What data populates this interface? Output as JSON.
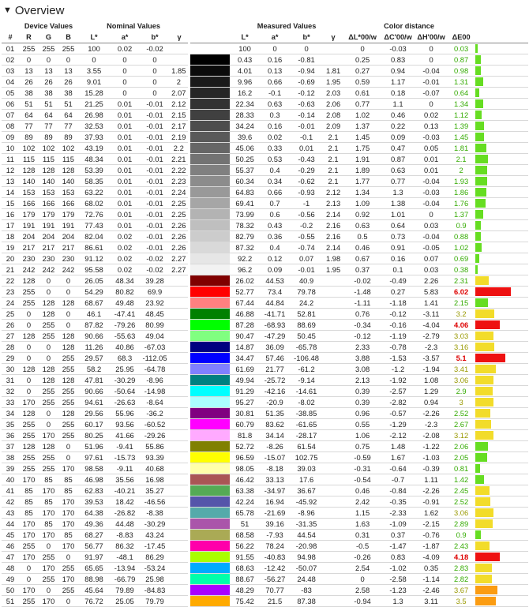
{
  "section": {
    "toggle_icon": "triangle-down-icon",
    "title": "Overview"
  },
  "groups": {
    "device": "Device Values",
    "nominal": "Nominal Values",
    "measured": "Measured Values",
    "distance": "Color distance"
  },
  "columns": [
    "#",
    "R",
    "G",
    "B",
    "L*",
    "a*",
    "b*",
    "γ",
    "",
    "L*",
    "a*",
    "b*",
    "γ",
    "ΔL*00/w",
    "ΔC'00/w",
    "ΔH'00/w",
    "ΔE00",
    ""
  ],
  "colors": {
    "good": "#66dd22",
    "ok": "#f2dc2a",
    "warn": "#fb9c12",
    "bad": "#ee1111",
    "bad_text": "#dd0000",
    "good_text": "#33aa00",
    "ok_text": "#999900"
  },
  "rows": [
    [
      "01",
      "255",
      "255",
      "255",
      "100",
      "0.02",
      "-0.02",
      "",
      "#ffffff",
      "100",
      "0",
      "0",
      "",
      "0",
      "-0.03",
      "0",
      "0.03"
    ],
    [
      "02",
      "0",
      "0",
      "0",
      "0",
      "0",
      "0",
      "",
      "#000000",
      "0.43",
      "0.16",
      "-0.81",
      "",
      "0.25",
      "0.83",
      "0",
      "0.87"
    ],
    [
      "03",
      "13",
      "13",
      "13",
      "3.55",
      "0",
      "0",
      "1.85",
      "#0b0b0b",
      "4.01",
      "0.13",
      "-0.94",
      "1.81",
      "0.27",
      "0.94",
      "-0.04",
      "0.98"
    ],
    [
      "04",
      "26",
      "26",
      "26",
      "9.01",
      "0",
      "0",
      "2",
      "#1a1a1a",
      "9.96",
      "0.66",
      "-0.69",
      "1.95",
      "0.59",
      "1.17",
      "-0.01",
      "1.31"
    ],
    [
      "05",
      "38",
      "38",
      "38",
      "15.28",
      "0",
      "0",
      "2.07",
      "#262626",
      "16.2",
      "-0.1",
      "-0.12",
      "2.03",
      "0.61",
      "0.18",
      "-0.07",
      "0.64"
    ],
    [
      "06",
      "51",
      "51",
      "51",
      "21.25",
      "0.01",
      "-0.01",
      "2.12",
      "#333333",
      "22.34",
      "0.63",
      "-0.63",
      "2.06",
      "0.77",
      "1.1",
      "0",
      "1.34"
    ],
    [
      "07",
      "64",
      "64",
      "64",
      "26.98",
      "0.01",
      "-0.01",
      "2.15",
      "#404040",
      "28.33",
      "0.3",
      "-0.14",
      "2.08",
      "1.02",
      "0.46",
      "0.02",
      "1.12"
    ],
    [
      "08",
      "77",
      "77",
      "77",
      "32.53",
      "0.01",
      "-0.01",
      "2.17",
      "#4d4d4d",
      "34.24",
      "0.16",
      "-0.01",
      "2.09",
      "1.37",
      "0.22",
      "0.13",
      "1.39"
    ],
    [
      "09",
      "89",
      "89",
      "89",
      "37.93",
      "0.01",
      "-0.01",
      "2.19",
      "#595959",
      "39.6",
      "0.02",
      "-0.1",
      "2.1",
      "1.45",
      "0.09",
      "-0.03",
      "1.45"
    ],
    [
      "10",
      "102",
      "102",
      "102",
      "43.19",
      "0.01",
      "-0.01",
      "2.2",
      "#666666",
      "45.06",
      "0.33",
      "0.01",
      "2.1",
      "1.75",
      "0.47",
      "0.05",
      "1.81"
    ],
    [
      "11",
      "115",
      "115",
      "115",
      "48.34",
      "0.01",
      "-0.01",
      "2.21",
      "#737373",
      "50.25",
      "0.53",
      "-0.43",
      "2.1",
      "1.91",
      "0.87",
      "0.01",
      "2.1"
    ],
    [
      "12",
      "128",
      "128",
      "128",
      "53.39",
      "0.01",
      "-0.01",
      "2.22",
      "#808080",
      "55.37",
      "0.4",
      "-0.29",
      "2.1",
      "1.89",
      "0.63",
      "0.01",
      "2"
    ],
    [
      "13",
      "140",
      "140",
      "140",
      "58.35",
      "0.01",
      "-0.01",
      "2.23",
      "#8c8c8c",
      "60.34",
      "0.34",
      "-0.62",
      "2.1",
      "1.77",
      "0.77",
      "-0.04",
      "1.93"
    ],
    [
      "14",
      "153",
      "153",
      "153",
      "63.22",
      "0.01",
      "-0.01",
      "2.24",
      "#999999",
      "64.83",
      "0.66",
      "-0.93",
      "2.12",
      "1.34",
      "1.3",
      "-0.03",
      "1.86"
    ],
    [
      "15",
      "166",
      "166",
      "166",
      "68.02",
      "0.01",
      "-0.01",
      "2.25",
      "#a6a6a6",
      "69.41",
      "0.7",
      "-1",
      "2.13",
      "1.09",
      "1.38",
      "-0.04",
      "1.76"
    ],
    [
      "16",
      "179",
      "179",
      "179",
      "72.76",
      "0.01",
      "-0.01",
      "2.25",
      "#b3b3b3",
      "73.99",
      "0.6",
      "-0.56",
      "2.14",
      "0.92",
      "1.01",
      "0",
      "1.37"
    ],
    [
      "17",
      "191",
      "191",
      "191",
      "77.43",
      "0.01",
      "-0.01",
      "2.26",
      "#bfbfbf",
      "78.32",
      "0.43",
      "-0.2",
      "2.16",
      "0.63",
      "0.64",
      "0.03",
      "0.9"
    ],
    [
      "18",
      "204",
      "204",
      "204",
      "82.04",
      "0.02",
      "-0.01",
      "2.26",
      "#cccccc",
      "82.79",
      "0.36",
      "-0.55",
      "2.16",
      "0.5",
      "0.73",
      "-0.04",
      "0.88"
    ],
    [
      "19",
      "217",
      "217",
      "217",
      "86.61",
      "0.02",
      "-0.01",
      "2.26",
      "#d9d9d9",
      "87.32",
      "0.4",
      "-0.74",
      "2.14",
      "0.46",
      "0.91",
      "-0.05",
      "1.02"
    ],
    [
      "20",
      "230",
      "230",
      "230",
      "91.12",
      "0.02",
      "-0.02",
      "2.27",
      "#e6e6e6",
      "92.2",
      "0.12",
      "0.07",
      "1.98",
      "0.67",
      "0.16",
      "0.07",
      "0.69"
    ],
    [
      "21",
      "242",
      "242",
      "242",
      "95.58",
      "0.02",
      "-0.02",
      "2.27",
      "#f2f2f2",
      "96.2",
      "0.09",
      "-0.01",
      "1.95",
      "0.37",
      "0.1",
      "0.03",
      "0.38"
    ],
    [
      "22",
      "128",
      "0",
      "0",
      "26.05",
      "48.34",
      "39.28",
      "",
      "#800000",
      "26.02",
      "44.53",
      "40.9",
      "",
      "-0.02",
      "-0.49",
      "2.26",
      "2.31"
    ],
    [
      "23",
      "255",
      "0",
      "0",
      "54.29",
      "80.82",
      "69.9",
      "",
      "#ff0000",
      "52.77",
      "73.4",
      "79.78",
      "",
      "-1.48",
      "0.27",
      "5.83",
      "6.02"
    ],
    [
      "24",
      "255",
      "128",
      "128",
      "68.67",
      "49.48",
      "23.92",
      "",
      "#ff8080",
      "67.44",
      "44.84",
      "24.2",
      "",
      "-1.11",
      "-1.18",
      "1.41",
      "2.15"
    ],
    [
      "25",
      "0",
      "128",
      "0",
      "46.1",
      "-47.41",
      "48.45",
      "",
      "#008000",
      "46.88",
      "-41.71",
      "52.81",
      "",
      "0.76",
      "-0.12",
      "-3.11",
      "3.2"
    ],
    [
      "26",
      "0",
      "255",
      "0",
      "87.82",
      "-79.26",
      "80.99",
      "",
      "#00ff00",
      "87.28",
      "-68.93",
      "88.69",
      "",
      "-0.34",
      "-0.16",
      "-4.04",
      "4.06"
    ],
    [
      "27",
      "128",
      "255",
      "128",
      "90.66",
      "-55.63",
      "49.04",
      "",
      "#80ff80",
      "90.47",
      "-47.29",
      "50.45",
      "",
      "-0.12",
      "-1.19",
      "-2.79",
      "3.03"
    ],
    [
      "28",
      "0",
      "0",
      "128",
      "11.26",
      "40.86",
      "-67.03",
      "",
      "#000080",
      "14.87",
      "36.09",
      "-65.78",
      "",
      "2.33",
      "-0.78",
      "-2.3",
      "3.16"
    ],
    [
      "29",
      "0",
      "0",
      "255",
      "29.57",
      "68.3",
      "-112.05",
      "",
      "#0000ff",
      "34.47",
      "57.46",
      "-106.48",
      "",
      "3.88",
      "-1.53",
      "-3.57",
      "5.1"
    ],
    [
      "30",
      "128",
      "128",
      "255",
      "58.2",
      "25.95",
      "-64.78",
      "",
      "#8080ff",
      "61.69",
      "21.77",
      "-61.2",
      "",
      "3.08",
      "-1.2",
      "-1.94",
      "3.41"
    ],
    [
      "31",
      "0",
      "128",
      "128",
      "47.81",
      "-30.29",
      "-8.96",
      "",
      "#008080",
      "49.94",
      "-25.72",
      "-9.14",
      "",
      "2.13",
      "-1.92",
      "1.08",
      "3.06"
    ],
    [
      "32",
      "0",
      "255",
      "255",
      "90.66",
      "-50.64",
      "-14.98",
      "",
      "#00ffff",
      "91.29",
      "-42.16",
      "-14.61",
      "",
      "0.39",
      "-2.57",
      "1.29",
      "2.9"
    ],
    [
      "33",
      "170",
      "255",
      "255",
      "94.61",
      "-26.63",
      "-8.64",
      "",
      "#aaffff",
      "95.27",
      "-20.9",
      "-8.02",
      "",
      "0.39",
      "-2.82",
      "0.94",
      "3"
    ],
    [
      "34",
      "128",
      "0",
      "128",
      "29.56",
      "55.96",
      "-36.2",
      "",
      "#800080",
      "30.81",
      "51.35",
      "-38.85",
      "",
      "0.96",
      "-0.57",
      "-2.26",
      "2.52"
    ],
    [
      "35",
      "255",
      "0",
      "255",
      "60.17",
      "93.56",
      "-60.52",
      "",
      "#ff00ff",
      "60.79",
      "83.62",
      "-61.65",
      "",
      "0.55",
      "-1.29",
      "-2.3",
      "2.67"
    ],
    [
      "36",
      "255",
      "170",
      "255",
      "80.25",
      "41.66",
      "-29.26",
      "",
      "#ffaaff",
      "81.8",
      "34.14",
      "-28.17",
      "",
      "1.06",
      "-2.12",
      "-2.08",
      "3.12"
    ],
    [
      "37",
      "128",
      "128",
      "0",
      "51.96",
      "-9.41",
      "55.86",
      "",
      "#808000",
      "52.72",
      "-8.26",
      "61.54",
      "",
      "0.75",
      "1.48",
      "-1.22",
      "2.06"
    ],
    [
      "38",
      "255",
      "255",
      "0",
      "97.61",
      "-15.73",
      "93.39",
      "",
      "#ffff00",
      "96.59",
      "-15.07",
      "102.75",
      "",
      "-0.59",
      "1.67",
      "-1.03",
      "2.05"
    ],
    [
      "39",
      "255",
      "255",
      "170",
      "98.58",
      "-9.11",
      "40.68",
      "",
      "#ffffaa",
      "98.05",
      "-8.18",
      "39.03",
      "",
      "-0.31",
      "-0.64",
      "-0.39",
      "0.81"
    ],
    [
      "40",
      "170",
      "85",
      "85",
      "46.98",
      "35.56",
      "16.98",
      "",
      "#aa5555",
      "46.42",
      "33.13",
      "17.6",
      "",
      "-0.54",
      "-0.7",
      "1.11",
      "1.42"
    ],
    [
      "41",
      "85",
      "170",
      "85",
      "62.83",
      "-40.21",
      "35.27",
      "",
      "#55aa55",
      "63.38",
      "-34.97",
      "36.67",
      "",
      "0.46",
      "-0.84",
      "-2.26",
      "2.45"
    ],
    [
      "42",
      "85",
      "85",
      "170",
      "39.53",
      "18.42",
      "-46.56",
      "",
      "#5555aa",
      "42.24",
      "16.94",
      "-45.92",
      "",
      "2.42",
      "-0.35",
      "-0.91",
      "2.52"
    ],
    [
      "43",
      "85",
      "170",
      "170",
      "64.38",
      "-26.82",
      "-8.38",
      "",
      "#55aaaa",
      "65.78",
      "-21.69",
      "-8.96",
      "",
      "1.15",
      "-2.33",
      "1.62",
      "3.06"
    ],
    [
      "44",
      "170",
      "85",
      "170",
      "49.36",
      "44.48",
      "-30.29",
      "",
      "#aa55aa",
      "51",
      "39.16",
      "-31.35",
      "",
      "1.63",
      "-1.09",
      "-2.15",
      "2.89"
    ],
    [
      "45",
      "170",
      "170",
      "85",
      "68.27",
      "-8.83",
      "43.24",
      "",
      "#aaaa55",
      "68.58",
      "-7.93",
      "44.54",
      "",
      "0.31",
      "0.37",
      "-0.76",
      "0.9"
    ],
    [
      "46",
      "255",
      "0",
      "170",
      "56.77",
      "86.32",
      "-17.45",
      "",
      "#ff00aa",
      "56.22",
      "78.24",
      "-20.98",
      "",
      "-0.5",
      "-1.47",
      "-1.87",
      "2.43"
    ],
    [
      "47",
      "170",
      "255",
      "0",
      "91.97",
      "-48.1",
      "86.29",
      "",
      "#aaff00",
      "91.55",
      "-40.83",
      "94.98",
      "",
      "-0.26",
      "0.83",
      "-4.09",
      "4.18"
    ],
    [
      "48",
      "0",
      "170",
      "255",
      "65.65",
      "-13.94",
      "-53.24",
      "",
      "#00aaff",
      "68.63",
      "-12.42",
      "-50.07",
      "",
      "2.54",
      "-1.02",
      "0.35",
      "2.83"
    ],
    [
      "49",
      "0",
      "255",
      "170",
      "88.98",
      "-66.79",
      "25.98",
      "",
      "#00ffaa",
      "88.67",
      "-56.27",
      "24.48",
      "",
      "0",
      "-2.58",
      "-1.14",
      "2.82"
    ],
    [
      "50",
      "170",
      "0",
      "255",
      "45.64",
      "79.89",
      "-84.83",
      "",
      "#aa00ff",
      "48.29",
      "70.77",
      "-83",
      "",
      "2.58",
      "-1.23",
      "-2.46",
      "3.67"
    ],
    [
      "51",
      "255",
      "170",
      "0",
      "76.72",
      "25.05",
      "79.79",
      "",
      "#ffaa00",
      "75.42",
      "21.5",
      "87.38",
      "",
      "-0.94",
      "1.3",
      "3.11",
      "3.5"
    ]
  ]
}
